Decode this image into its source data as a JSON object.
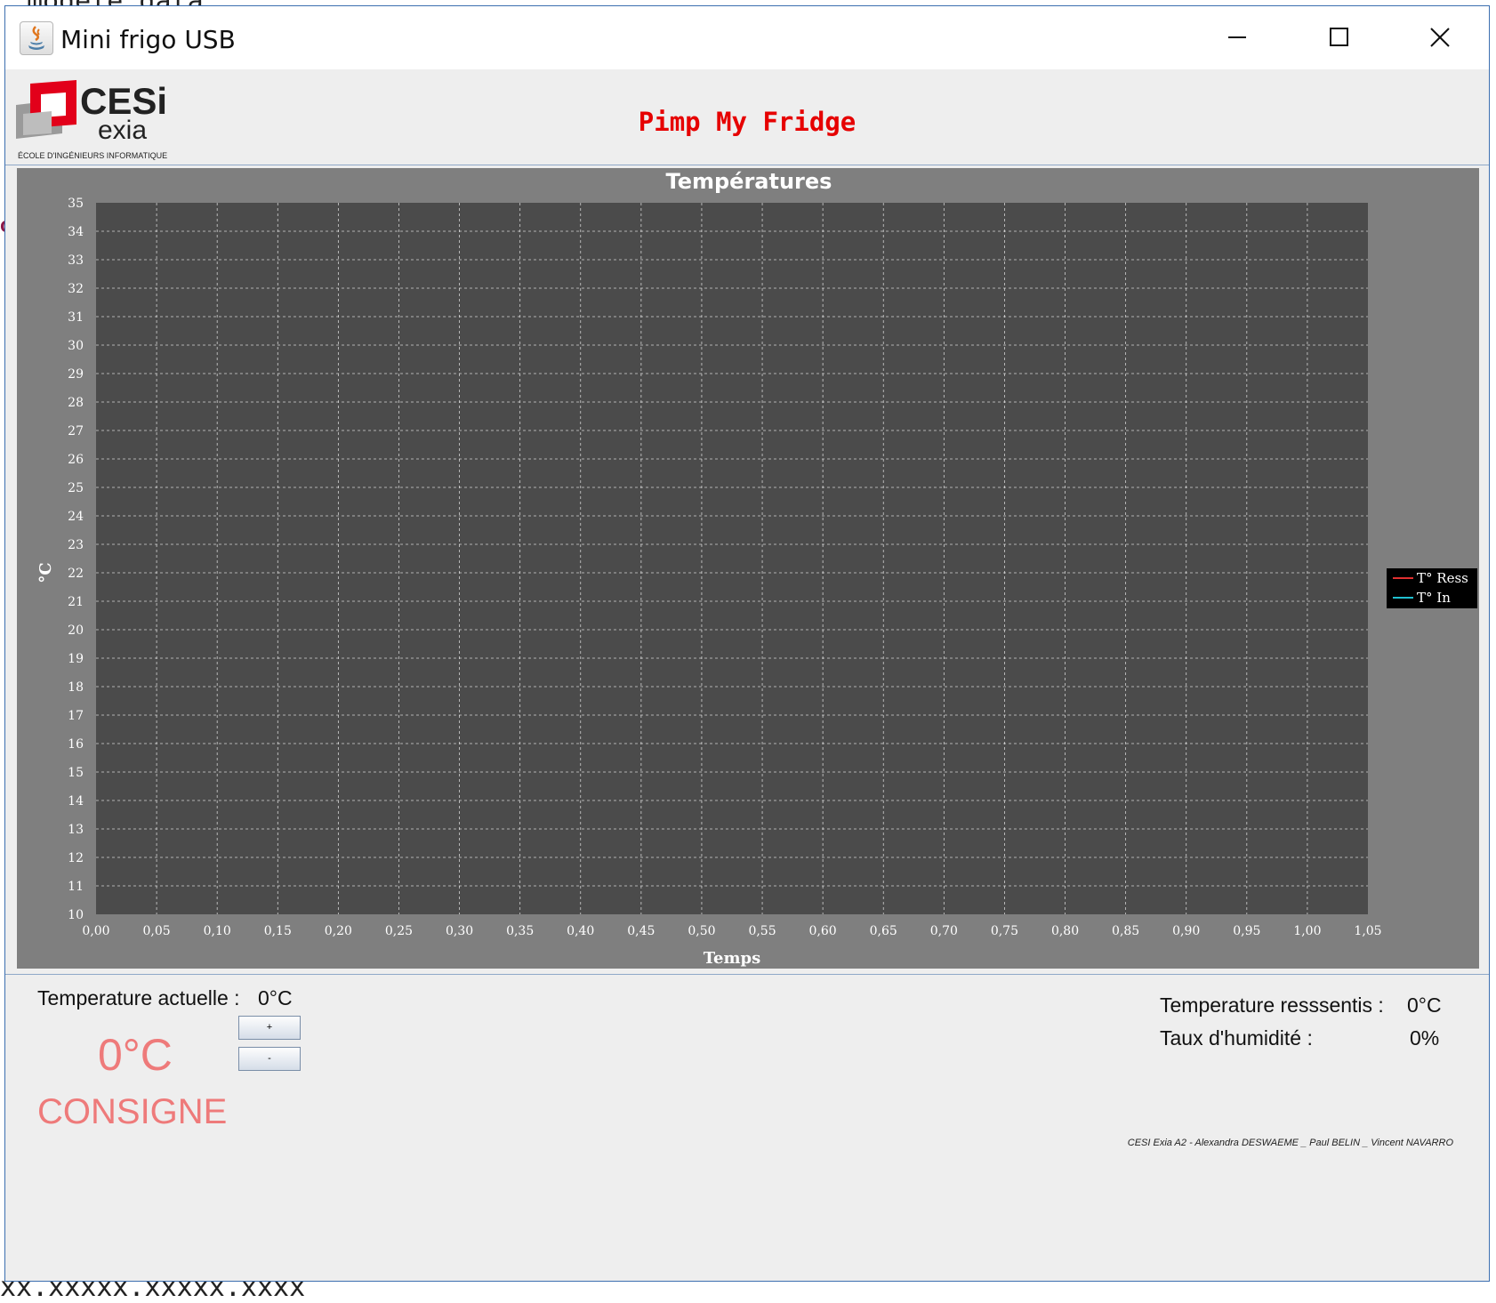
{
  "background": {
    "top_code_text": "modele data;",
    "bottom_code_text": "xx.xxxxx.xxxxx.xxxx"
  },
  "window": {
    "title": "Mini frigo USB",
    "controls": {
      "minimize": "minimize-icon",
      "maximize": "maximize-icon",
      "close": "close-icon"
    }
  },
  "header": {
    "logo": {
      "brand": "CESi",
      "sub": "exia",
      "tagline": "ÉCOLE D'INGÉNIEURS INFORMATIQUE"
    },
    "app_title": "Pimp My Fridge"
  },
  "chart_data": {
    "type": "line",
    "title": "Températures",
    "xlabel": "Temps",
    "ylabel": "°C",
    "xlim": [
      0,
      1.05
    ],
    "ylim": [
      10,
      35
    ],
    "x_ticks": [
      "0,00",
      "0,05",
      "0,10",
      "0,15",
      "0,20",
      "0,25",
      "0,30",
      "0,35",
      "0,40",
      "0,45",
      "0,50",
      "0,55",
      "0,60",
      "0,65",
      "0,70",
      "0,75",
      "0,80",
      "0,85",
      "0,90",
      "0,95",
      "1,00",
      "1,05"
    ],
    "y_ticks": [
      "10",
      "11",
      "12",
      "13",
      "14",
      "15",
      "16",
      "17",
      "18",
      "19",
      "20",
      "21",
      "22",
      "23",
      "24",
      "25",
      "26",
      "27",
      "28",
      "29",
      "30",
      "31",
      "32",
      "33",
      "34",
      "35"
    ],
    "grid": true,
    "legend_position": "right",
    "series": [
      {
        "name": "T° Ress",
        "color": "#e03030",
        "values": []
      },
      {
        "name": "T° In",
        "color": "#20c0d0",
        "values": []
      }
    ]
  },
  "status": {
    "current_label": "Temperature actuelle :",
    "current_value": "0°C",
    "setpoint_value": "0°C",
    "setpoint_label": "CONSIGNE",
    "plus_label": "+",
    "minus_label": "-",
    "felt_label": "Temperature resssentis :",
    "felt_value": "0°C",
    "humidity_label": "Taux d'humidité :",
    "humidity_value": "0%",
    "credits": "CESI Exia A2 - Alexandra DESWAEME _ Paul BELIN _ Vincent NAVARRO"
  },
  "colors": {
    "accent_red": "#e60000",
    "consigne": "#ee7a7a",
    "chart_bg": "#7f7f7f",
    "plot_bg": "#4b4b4b"
  }
}
